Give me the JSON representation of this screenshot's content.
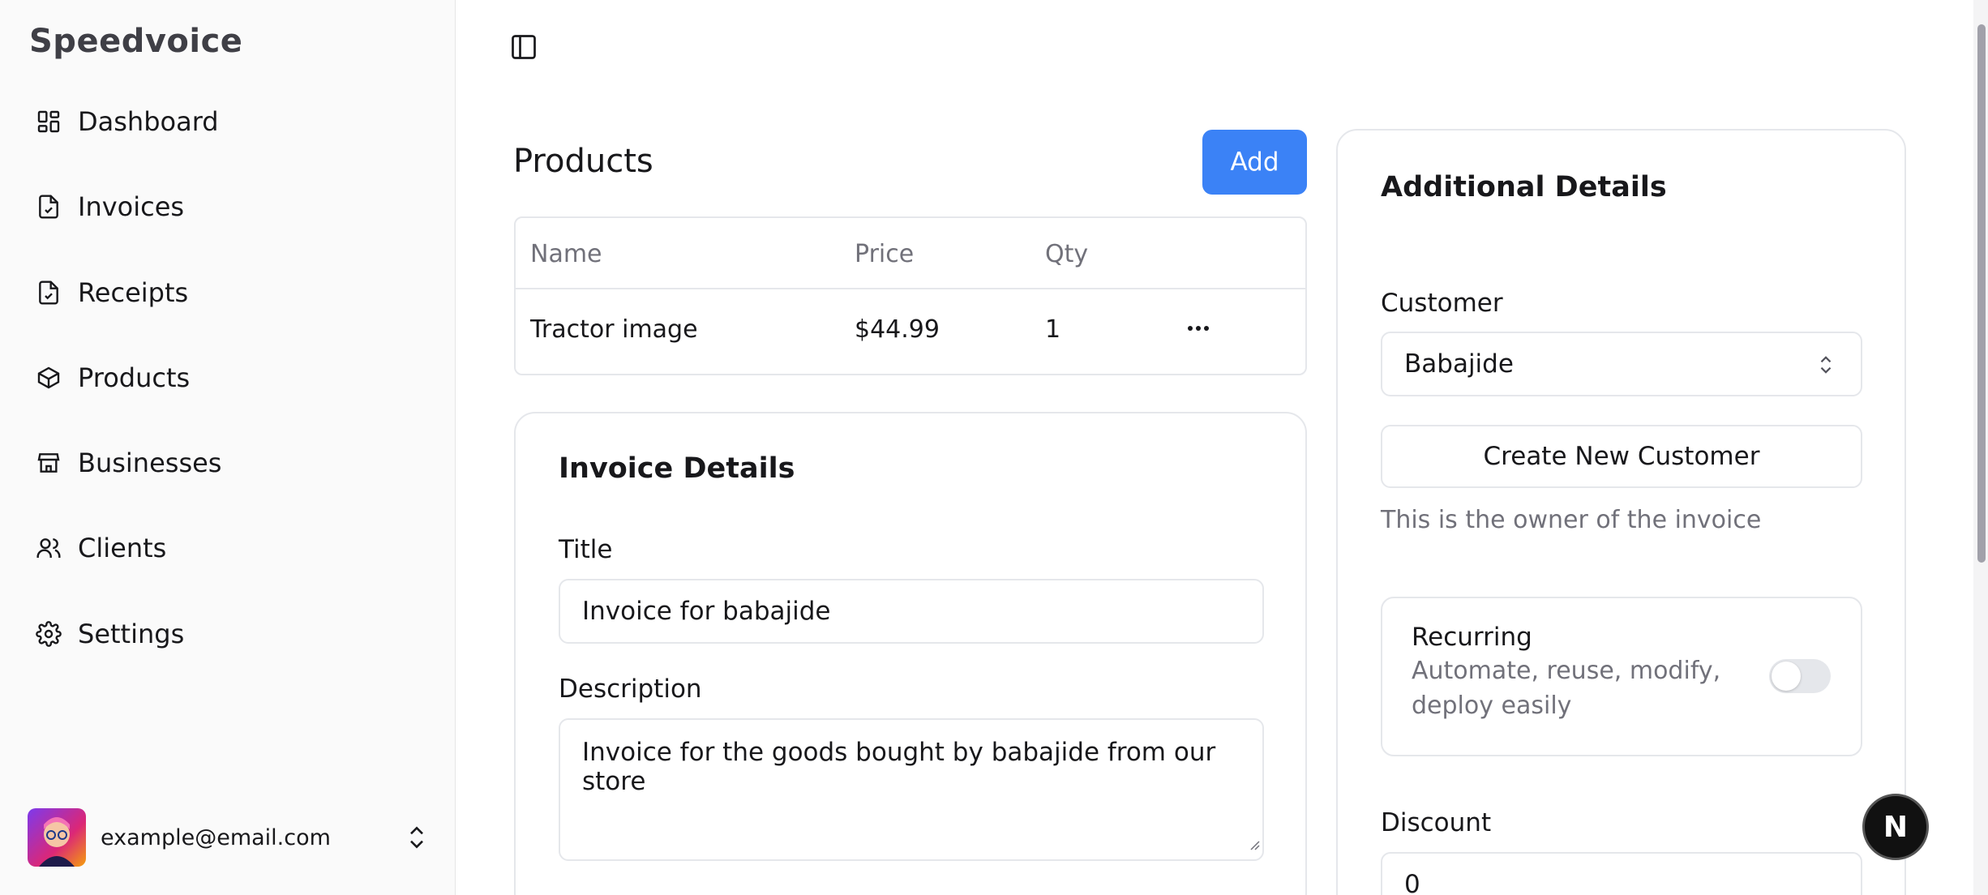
{
  "app": {
    "brand": "Speedvoice"
  },
  "sidebar": {
    "items": [
      {
        "label": "Dashboard",
        "icon": "dashboard-icon"
      },
      {
        "label": "Invoices",
        "icon": "invoice-icon"
      },
      {
        "label": "Receipts",
        "icon": "receipt-icon"
      },
      {
        "label": "Products",
        "icon": "package-icon"
      },
      {
        "label": "Businesses",
        "icon": "store-icon"
      },
      {
        "label": "Clients",
        "icon": "users-icon"
      },
      {
        "label": "Settings",
        "icon": "gear-icon"
      }
    ],
    "user": {
      "email": "example@email.com"
    }
  },
  "products": {
    "title": "Products",
    "add_label": "Add",
    "columns": [
      "Name",
      "Price",
      "Qty"
    ],
    "rows": [
      {
        "name": "Tractor image",
        "price": "$44.99",
        "qty": "1"
      }
    ]
  },
  "invoice_details": {
    "title": "Invoice Details",
    "title_label": "Title",
    "title_value": "Invoice for babajide",
    "description_label": "Description",
    "description_value": "Invoice for the goods bought by babajide from our store"
  },
  "additional_details": {
    "title": "Additional Details",
    "customer_label": "Customer",
    "customer_value": "Babajide",
    "create_customer_label": "Create New Customer",
    "customer_help": "This is the owner of the invoice",
    "recurring_label": "Recurring",
    "recurring_desc_line1": "Automate, reuse, modify,",
    "recurring_desc_line2": "deploy easily",
    "recurring_on": false,
    "discount_label": "Discount",
    "discount_value": "0"
  },
  "badge": {
    "letter": "N"
  },
  "colors": {
    "accent": "#3b82f6",
    "sidebar_bg": "#fafafa"
  }
}
